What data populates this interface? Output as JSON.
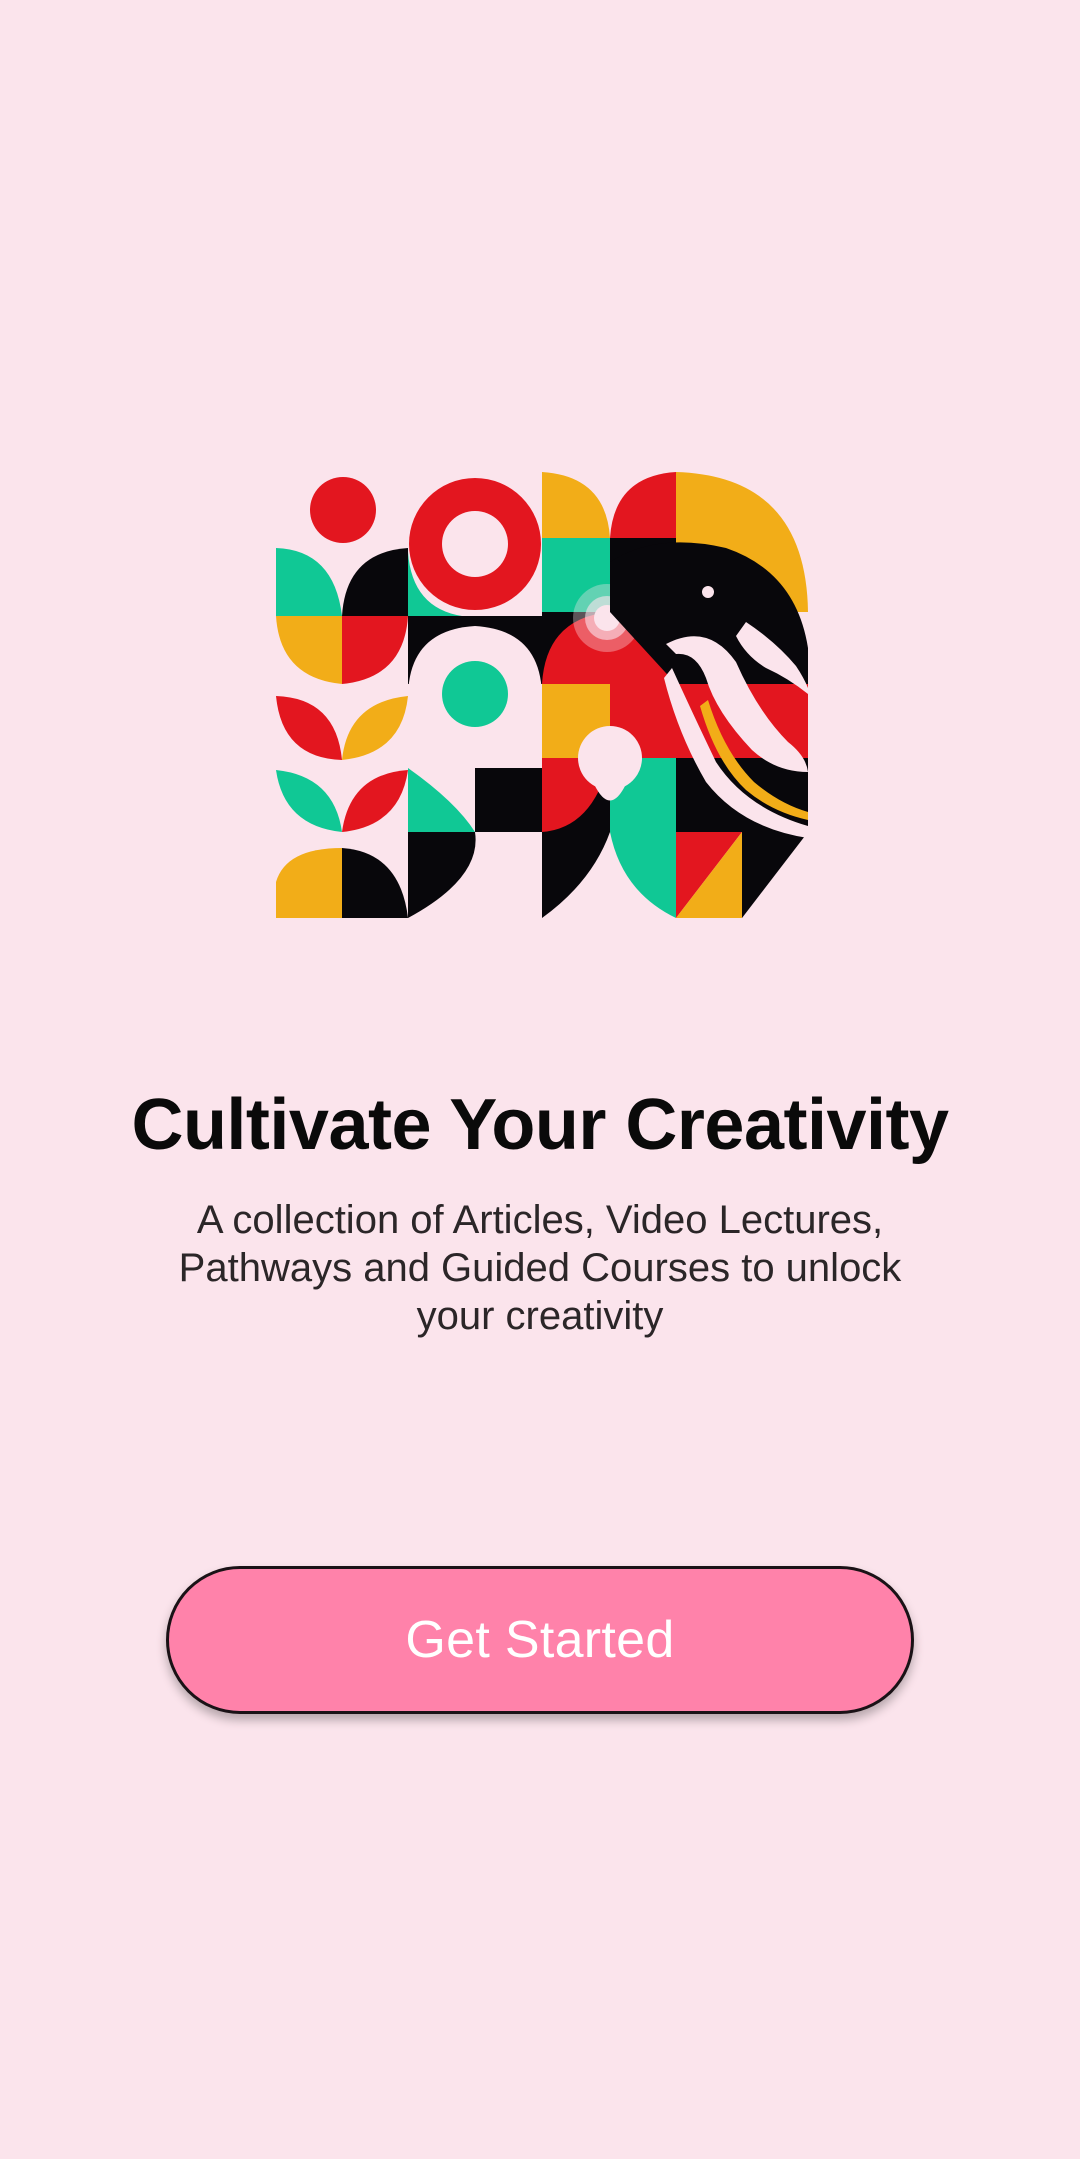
{
  "onboarding": {
    "title": "Cultivate Your Creativity",
    "subtitle": "A collection of Articles, Video Lectures, Pathways and Guided Courses to unlock your creativity",
    "cta_label": "Get Started",
    "illustration": "geometric-elephant-illustration"
  },
  "colors": {
    "background": "#fbe4ec",
    "button": "#ff82aa",
    "red": "#e3161f",
    "teal": "#10c895",
    "yellow": "#f2ad18",
    "black": "#08070b",
    "pink": "#fbe4ec"
  }
}
